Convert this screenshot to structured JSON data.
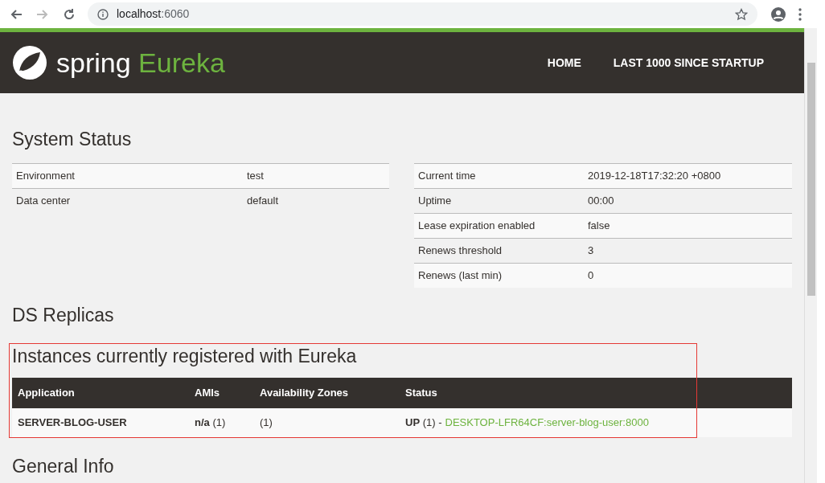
{
  "browser": {
    "url_host": "localhost",
    "url_port": ":6060"
  },
  "navbar": {
    "logo_word": "spring",
    "logo_product": "Eureka",
    "links": [
      {
        "label": "HOME"
      },
      {
        "label": "LAST 1000 SINCE STARTUP"
      }
    ]
  },
  "system_status": {
    "title": "System Status",
    "left_rows": [
      {
        "label": "Environment",
        "value": "test"
      },
      {
        "label": "Data center",
        "value": "default"
      }
    ],
    "right_rows": [
      {
        "label": "Current time",
        "value": "2019-12-18T17:32:20 +0800"
      },
      {
        "label": "Uptime",
        "value": "00:00"
      },
      {
        "label": "Lease expiration enabled",
        "value": "false"
      },
      {
        "label": "Renews threshold",
        "value": "3"
      },
      {
        "label": "Renews (last min)",
        "value": "0"
      }
    ]
  },
  "ds_replicas": {
    "title": "DS Replicas"
  },
  "instances": {
    "title": "Instances currently registered with Eureka",
    "highlighted": true,
    "columns": [
      "Application",
      "AMIs",
      "Availability Zones",
      "Status"
    ],
    "rows": [
      {
        "application": "SERVER-BLOG-USER",
        "amis": "**n/a** (1)",
        "zones": "(1)",
        "status": "**UP** (1) -",
        "instance_link": "DESKTOP-LFR64CF:server-blog-user:8000"
      }
    ]
  },
  "general_info": {
    "title": "General Info"
  }
}
